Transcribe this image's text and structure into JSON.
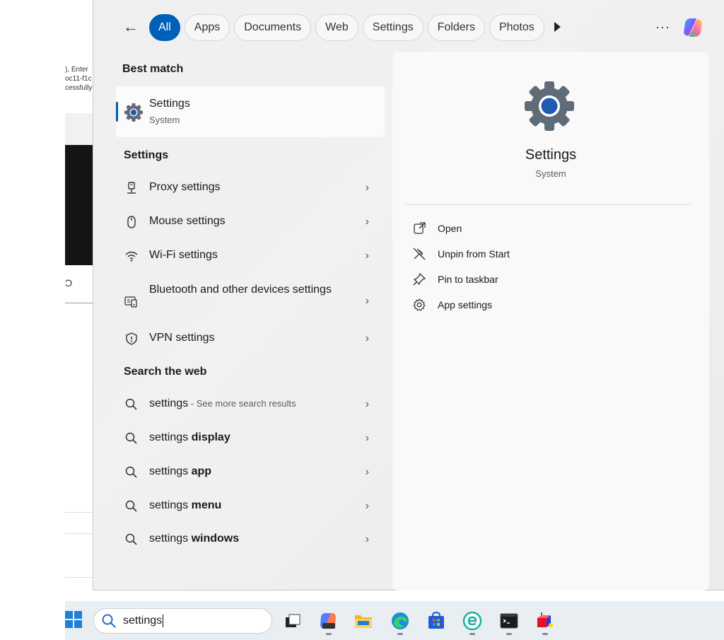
{
  "background_window": {
    "fragment_lines": [
      "), Enter",
      "oc11-f1c",
      "cessfully"
    ],
    "glyph": "Ɔ"
  },
  "topbar": {
    "tabs": [
      "All",
      "Apps",
      "Documents",
      "Web",
      "Settings",
      "Folders",
      "Photos"
    ],
    "active_tab": "All",
    "more_label": "···"
  },
  "results": {
    "best_match_heading": "Best match",
    "best_match": {
      "title": "Settings",
      "subtitle": "System",
      "icon": "gear-icon"
    },
    "settings_heading": "Settings",
    "settings_items": [
      {
        "label": "Proxy settings",
        "icon": "proxy-icon"
      },
      {
        "label": "Mouse settings",
        "icon": "mouse-icon"
      },
      {
        "label": "Wi-Fi settings",
        "icon": "wifi-icon"
      },
      {
        "label": "Bluetooth and other devices settings",
        "icon": "bluetooth-devices-icon"
      },
      {
        "label": "VPN settings",
        "icon": "vpn-shield-icon"
      }
    ],
    "web_heading": "Search the web",
    "web_items": [
      {
        "query": "settings",
        "bold": "",
        "hint": " - See more search results"
      },
      {
        "query": "settings ",
        "bold": "display",
        "hint": ""
      },
      {
        "query": "settings ",
        "bold": "app",
        "hint": ""
      },
      {
        "query": "settings ",
        "bold": "menu",
        "hint": ""
      },
      {
        "query": "settings ",
        "bold": "windows",
        "hint": ""
      }
    ]
  },
  "detail": {
    "title": "Settings",
    "subtitle": "System",
    "actions": [
      {
        "label": "Open",
        "icon": "open-external-icon"
      },
      {
        "label": "Unpin from Start",
        "icon": "unpin-icon"
      },
      {
        "label": "Pin to taskbar",
        "icon": "pin-icon"
      },
      {
        "label": "App settings",
        "icon": "gear-outline-icon"
      }
    ]
  },
  "taskbar": {
    "search_value": "settings",
    "apps": [
      "task-view",
      "microsoft-365-copilot",
      "file-explorer",
      "edge",
      "microsoft-store",
      "eset",
      "terminal",
      "paint-3d"
    ]
  },
  "colors": {
    "accent": "#005fb8",
    "panel_bg": "#efefef",
    "detail_bg": "#f9f9f9",
    "taskbar_bg": "#e9eef3"
  }
}
